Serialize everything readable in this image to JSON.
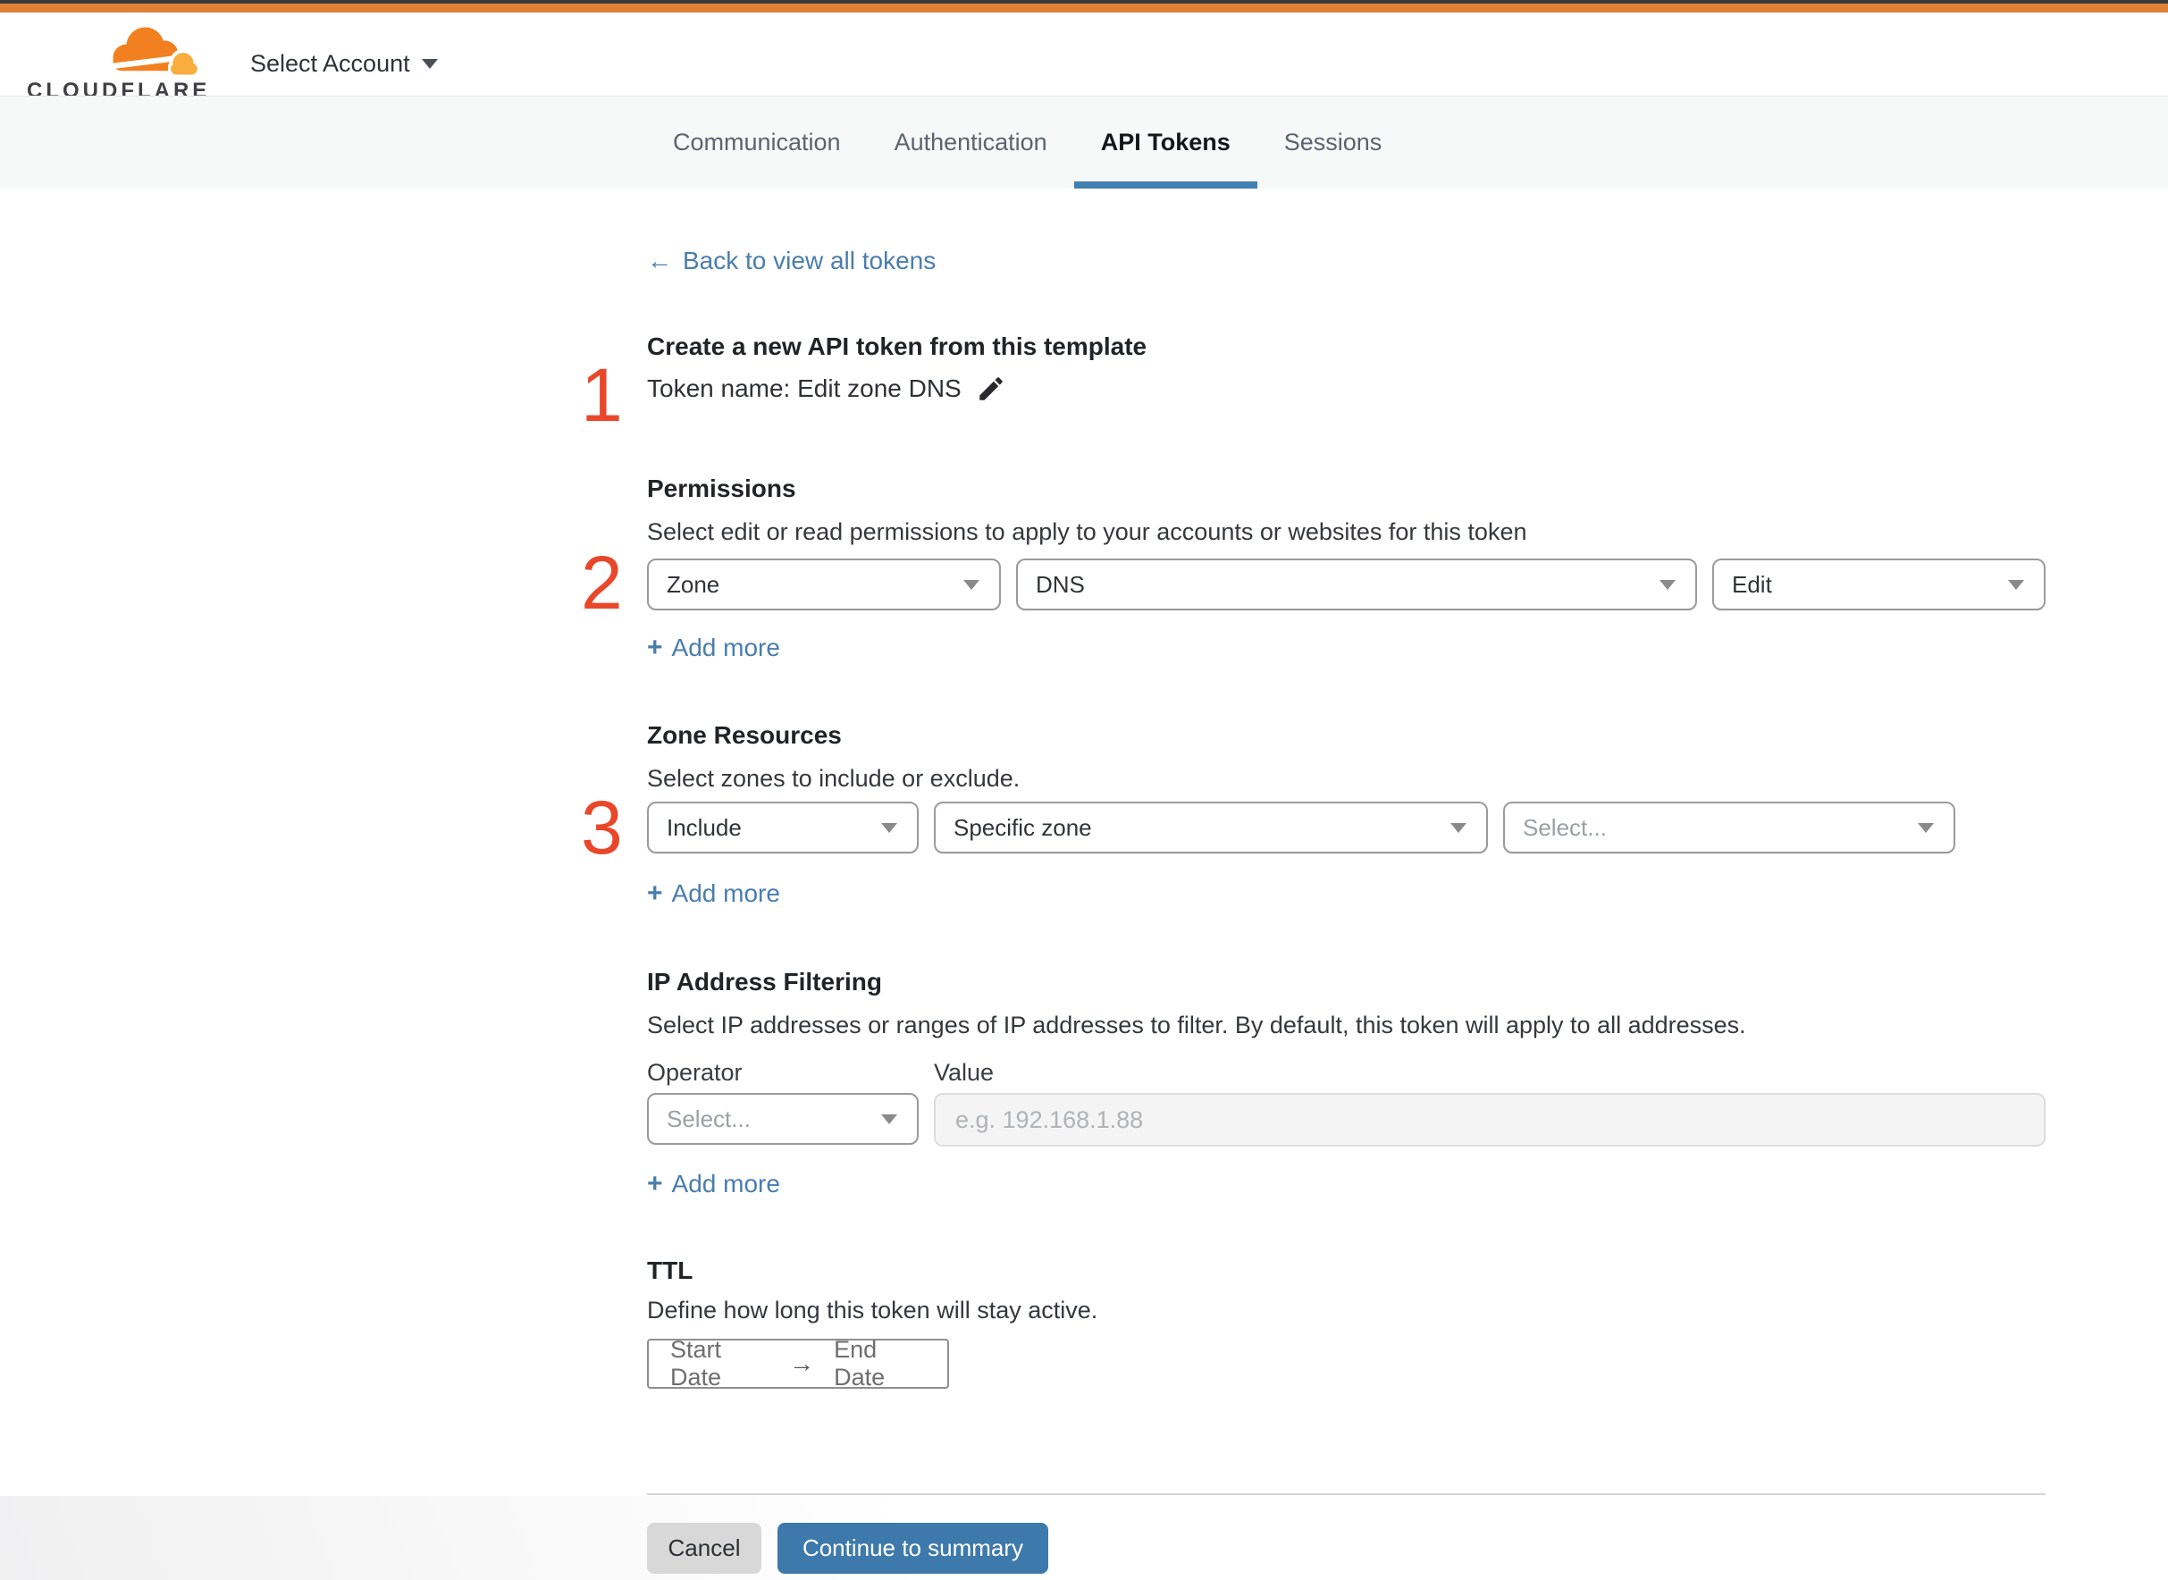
{
  "header": {
    "brand": "CLOUDFLARE",
    "account_selector": "Select Account"
  },
  "tabs": [
    {
      "label": "Communication",
      "active": false
    },
    {
      "label": "Authentication",
      "active": false
    },
    {
      "label": "API Tokens",
      "active": true
    },
    {
      "label": "Sessions",
      "active": false
    }
  ],
  "icons": {
    "back_arrow": "←",
    "plus": "+",
    "range_arrow": "→"
  },
  "back_link": {
    "label": "Back to view all tokens"
  },
  "steps": {
    "one": "1",
    "two": "2",
    "three": "3"
  },
  "token_section": {
    "title": "Create a new API token from this template",
    "token_name": "Token name: Edit zone DNS"
  },
  "permissions": {
    "title": "Permissions",
    "description": "Select edit or read permissions to apply to your accounts or websites for this token",
    "selects": [
      {
        "value": "Zone"
      },
      {
        "value": "DNS"
      },
      {
        "value": "Edit"
      }
    ],
    "add_more": "Add more"
  },
  "zone_resources": {
    "title": "Zone Resources",
    "description": "Select zones to include or exclude.",
    "selects": [
      {
        "value": "Include"
      },
      {
        "value": "Specific zone"
      },
      {
        "value": "Select..."
      }
    ],
    "add_more": "Add more"
  },
  "ip_filtering": {
    "title": "IP Address Filtering",
    "description": "Select IP addresses or ranges of IP addresses to filter. By default, this token will apply to all addresses.",
    "operator_label": "Operator",
    "value_label": "Value",
    "operator_select": "Select...",
    "value_placeholder": "e.g. 192.168.1.88",
    "add_more": "Add more"
  },
  "ttl": {
    "title": "TTL",
    "description": "Define how long this token will stay active.",
    "start_placeholder": "Start Date",
    "end_placeholder": "End Date"
  },
  "footer": {
    "cancel": "Cancel",
    "continue": "Continue to summary"
  },
  "colors": {
    "top_orange": "#e08136",
    "brand_orange": "#f38020",
    "brand_orange_light": "#faad3f",
    "step_number_red": "#e9472a",
    "link_blue": "#4a7dad",
    "button_blue": "#3e79ab",
    "tab_underline_blue": "#4180b1"
  }
}
